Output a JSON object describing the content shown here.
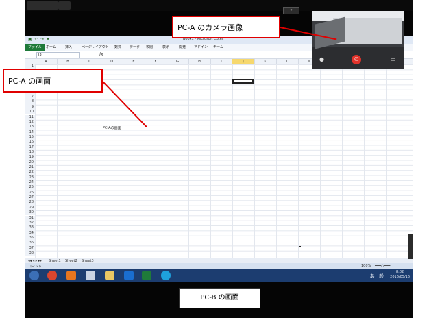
{
  "callouts": {
    "camera": "PC-A のカメラ画像",
    "screen_a": "PC-A の画面",
    "screen_b": "PC-B の画面"
  },
  "excel": {
    "title": "Book1 - Microsoft Excel",
    "ribbon_tabs": [
      "ファイル",
      "ホーム",
      "挿入",
      "ページレイアウト",
      "数式",
      "データ",
      "校閲",
      "表示",
      "開発",
      "アドイン",
      "チーム"
    ],
    "name_box": "J3",
    "formula_symbol": "fx",
    "columns": [
      "A",
      "B",
      "C",
      "D",
      "E",
      "F",
      "G",
      "H",
      "I",
      "J",
      "K",
      "L",
      "M"
    ],
    "selected_column": "J",
    "rows": [
      "1",
      "2",
      "3",
      "4",
      "5",
      "6",
      "7",
      "8",
      "9",
      "10",
      "11",
      "12",
      "13",
      "14",
      "15",
      "16",
      "17",
      "18",
      "19",
      "20",
      "21",
      "22",
      "23",
      "24",
      "25",
      "26",
      "27",
      "28",
      "29",
      "30",
      "31",
      "32",
      "33",
      "34",
      "35",
      "36",
      "37",
      "38"
    ],
    "cell_text": "PC-Aの画面",
    "sheets": [
      "Sheet1",
      "Sheet2",
      "Sheet3"
    ],
    "status_left": "コマンド",
    "zoom": "100%"
  },
  "taskbar": {
    "tray_text": "あ 般",
    "clock_time": "8:02",
    "clock_date": "2016/05/16"
  },
  "colors": {
    "callout_border": "#e00000",
    "taskbar": "#1c3d70",
    "excel_green": "#1f7a3a",
    "selected_col": "#f6d86e"
  }
}
